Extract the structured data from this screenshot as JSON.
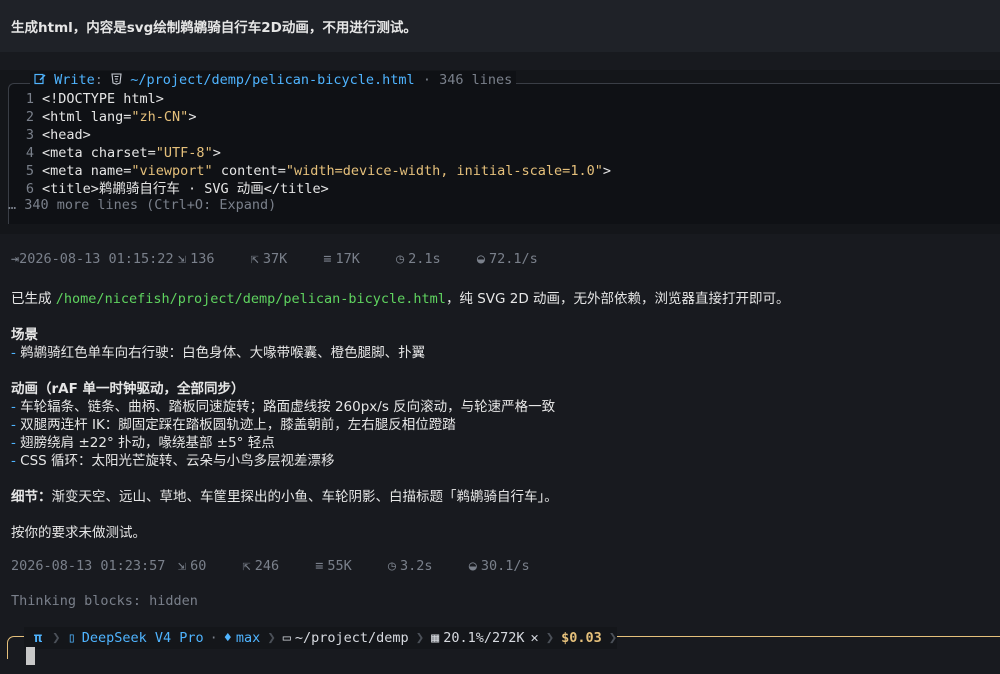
{
  "user_message": "生成html，内容是svg绘制鹈鹕骑自行车2D动画，不用进行测试。",
  "tool": {
    "icon": "write-icon",
    "verb": "Write",
    "file_icon": "html-file-icon",
    "path": "~/project/demp/pelican-bicycle.html",
    "meta": "· 346 lines",
    "lines": [
      {
        "n": "1",
        "parts": [
          {
            "t": "tag",
            "v": "<!DOCTYPE html>"
          }
        ]
      },
      {
        "n": "2",
        "parts": [
          {
            "t": "tag",
            "v": "<html lang="
          },
          {
            "t": "str",
            "v": "\"zh-CN\""
          },
          {
            "t": "tag",
            "v": ">"
          }
        ]
      },
      {
        "n": "3",
        "parts": [
          {
            "t": "tag",
            "v": "<head>"
          }
        ]
      },
      {
        "n": "4",
        "parts": [
          {
            "t": "tag",
            "v": "<meta charset="
          },
          {
            "t": "str",
            "v": "\"UTF-8\""
          },
          {
            "t": "tag",
            "v": ">"
          }
        ]
      },
      {
        "n": "5",
        "parts": [
          {
            "t": "tag",
            "v": "<meta name="
          },
          {
            "t": "str",
            "v": "\"viewport\""
          },
          {
            "t": "tag",
            "v": " content="
          },
          {
            "t": "str",
            "v": "\"width=device-width, initial-scale=1.0\""
          },
          {
            "t": "tag",
            "v": ">"
          }
        ]
      },
      {
        "n": "6",
        "parts": [
          {
            "t": "tag",
            "v": "<title>鹈鹕骑自行车 · SVG 动画</title>"
          }
        ]
      }
    ],
    "more": "… 340 more lines (Ctrl+O: Expand)"
  },
  "stats1": {
    "timestamp": "2026-08-13 01:15:22",
    "input": "136",
    "output": "37K",
    "cache": "17K",
    "time": "2.1s",
    "speed": "72.1/s"
  },
  "answer": {
    "line1_prefix": "已生成 ",
    "line1_path": "/home/nicefish/project/demp/pelican-bicycle.html",
    "line1_suffix": "，纯 SVG 2D 动画，无外部依赖，浏览器直接打开即可。",
    "scene_title": "场景",
    "scene_items": [
      "鹈鹕骑红色单车向右行驶：白色身体、大喙带喉囊、橙色腿脚、扑翼"
    ],
    "anim_title": "动画（rAF 单一时钟驱动，全部同步）",
    "anim_items": [
      "车轮辐条、链条、曲柄、踏板同速旋转；路面虚线按 260px/s 反向滚动，与轮速严格一致",
      "双腿两连杆 IK：脚固定踩在踏板圆轨迹上，膝盖朝前，左右腿反相位蹬踏",
      "翅膀绕肩 ±22° 扑动，喙绕基部 ±5° 轻点",
      "CSS 循环：太阳光芒旋转、云朵与小鸟多层视差漂移"
    ],
    "detail_label": "细节：",
    "detail_text": "渐变天空、远山、草地、车筐里探出的小鱼、车轮阴影、白描标题「鹈鹕骑自行车」。",
    "closing": "按你的要求未做测试。"
  },
  "stats2": {
    "timestamp": "2026-08-13 01:23:57",
    "input": "60",
    "output": "246",
    "cache": "55K",
    "time": "3.2s",
    "speed": "30.1/s"
  },
  "thinking": "Thinking blocks: hidden",
  "statusbar": {
    "app_glyph": "π",
    "model": "DeepSeek V4 Pro",
    "effort": "max",
    "dir": "~/project/demp",
    "context": "20.1%/272K",
    "cost": "$0.03"
  },
  "colors": {
    "accent": "#4fb4ff",
    "path_green": "#5fd35f",
    "string_yellow": "#e5c07b",
    "muted": "#7a808b"
  }
}
